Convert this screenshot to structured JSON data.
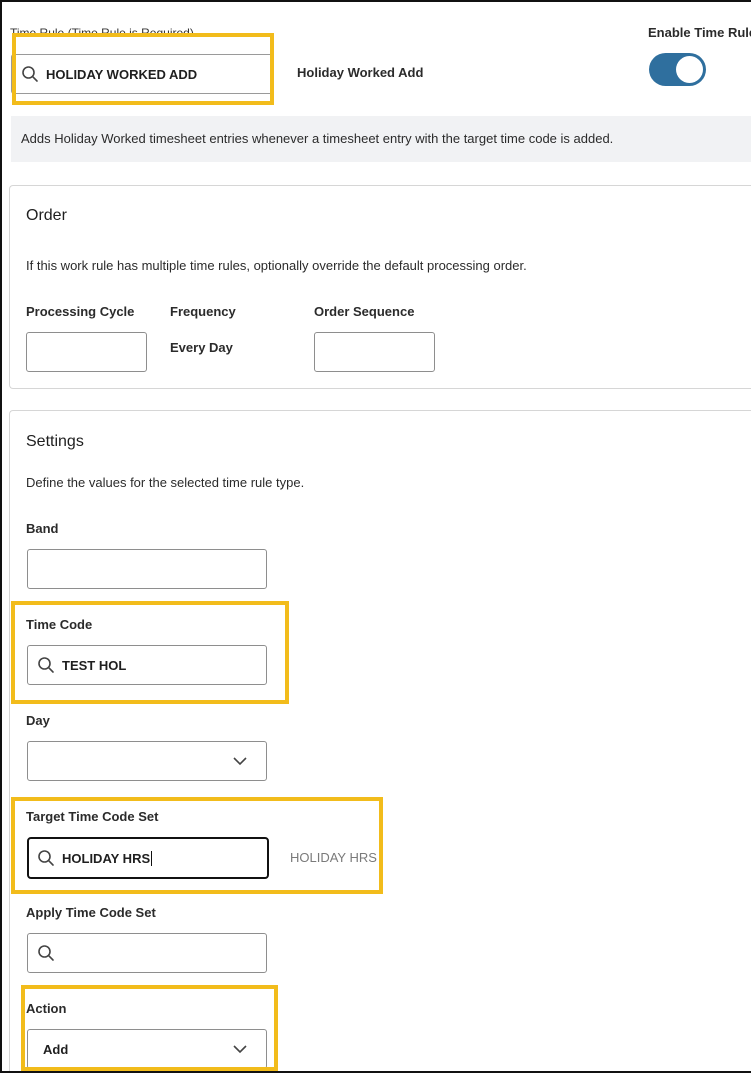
{
  "header": {
    "time_rule_label": "Time Rule (Time Rule is Required)",
    "time_rule_value": "HOLIDAY WORKED ADD",
    "time_rule_name": "Holiday Worked Add",
    "enable_label": "Enable Time Rule",
    "enabled": true,
    "description": "Adds Holiday Worked timesheet entries whenever a timesheet entry with the target time code is added."
  },
  "order": {
    "title": "Order",
    "description": "If this work rule has multiple time rules, optionally override the default processing order.",
    "processing_cycle_label": "Processing Cycle",
    "processing_cycle_value": "",
    "frequency_label": "Frequency",
    "frequency_value": "Every Day",
    "order_sequence_label": "Order Sequence",
    "order_sequence_value": ""
  },
  "settings": {
    "title": "Settings",
    "description": "Define the values for the selected time rule type.",
    "band_label": "Band",
    "band_value": "",
    "time_code_label": "Time Code",
    "time_code_value": "TEST HOL",
    "day_label": "Day",
    "day_value": "",
    "target_label": "Target Time Code Set",
    "target_value": "HOLIDAY HRS",
    "target_hint": "HOLIDAY HRS",
    "apply_label": "Apply Time Code Set",
    "apply_value": "",
    "action_label": "Action",
    "action_value": "Add"
  },
  "colors": {
    "highlight": "#f2bc1b",
    "toggle_on": "#2f6f9e",
    "description_bg": "#f1f2f4"
  },
  "icons": [
    "search-icon",
    "chevron-down-icon"
  ]
}
